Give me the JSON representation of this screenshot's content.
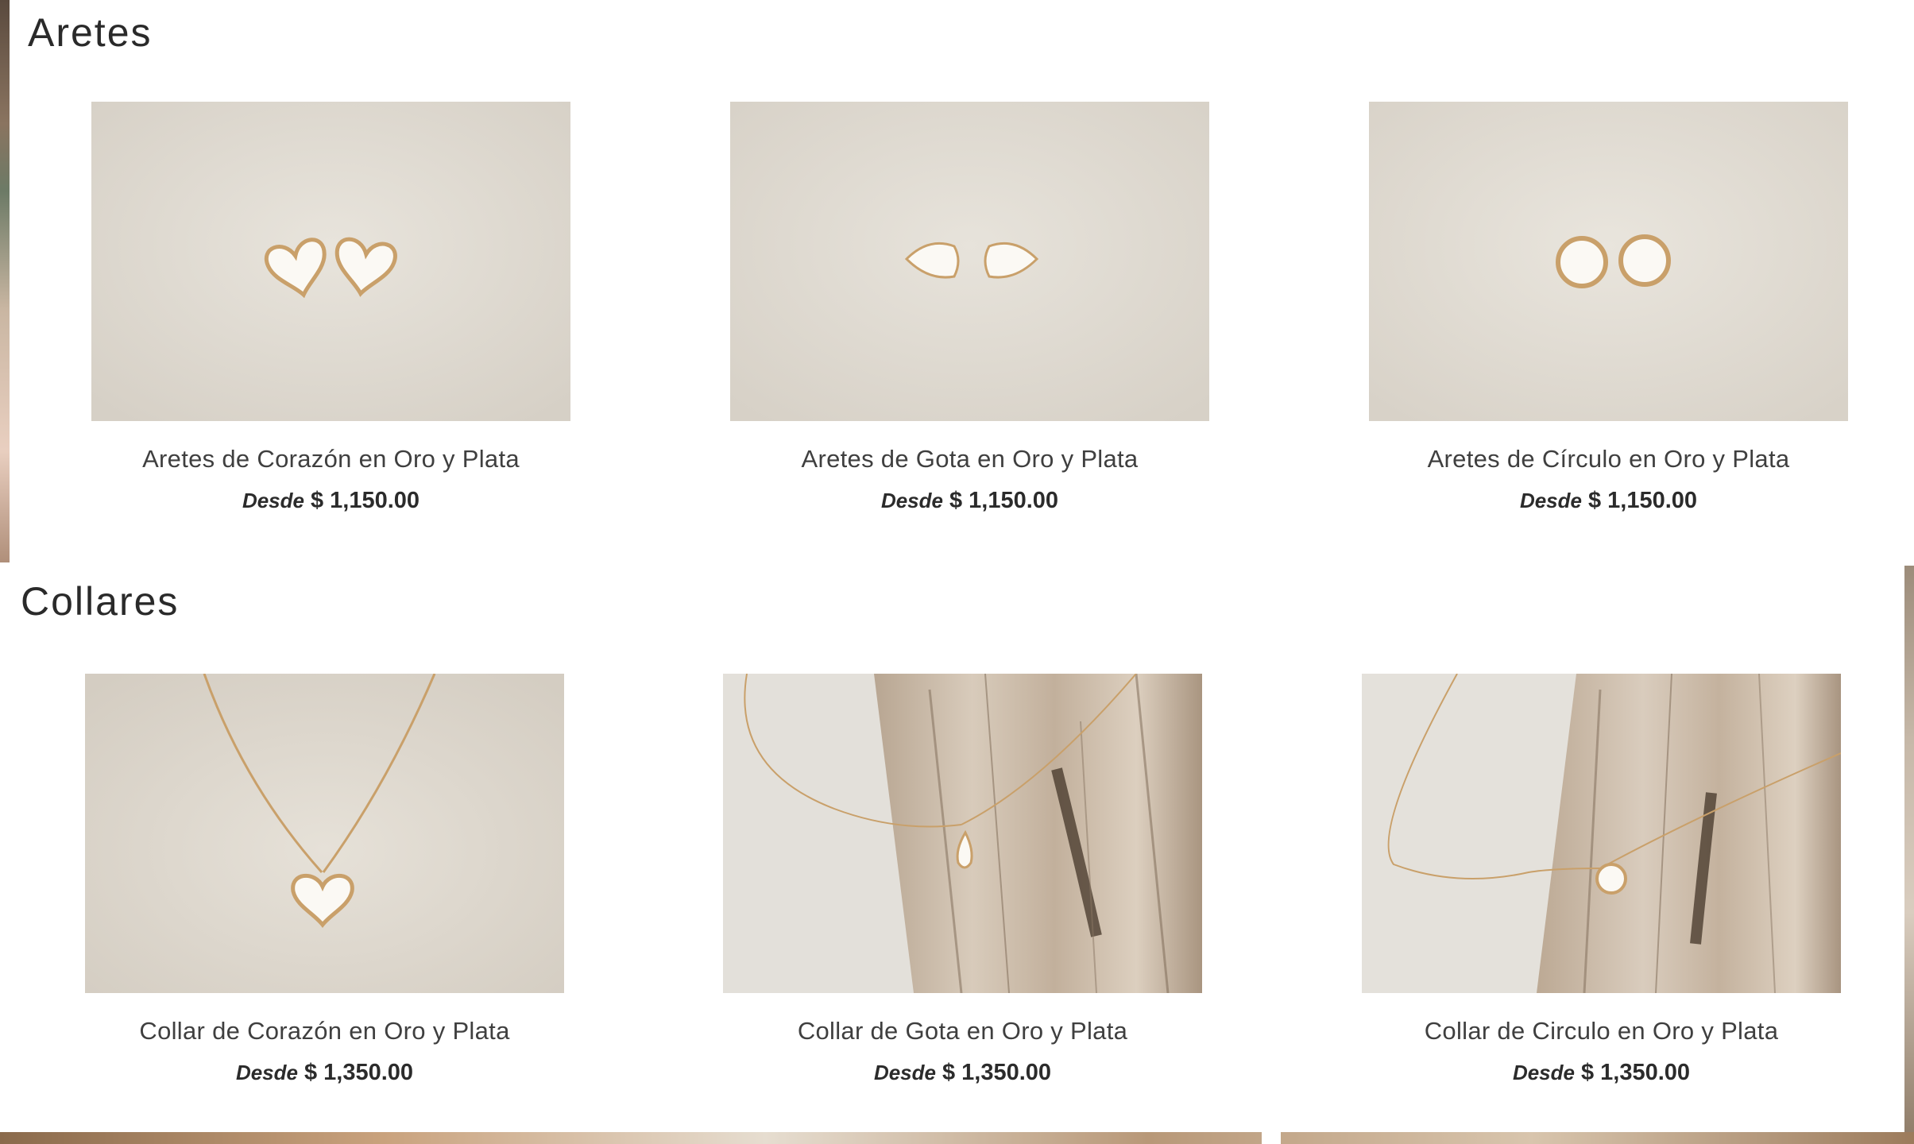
{
  "sections": [
    {
      "title": "Aretes",
      "products": [
        {
          "name": "Aretes de Corazón en Oro y Plata",
          "from_label": "Desde",
          "price": "$ 1,150.00",
          "image_icon": "heart-earrings-photo"
        },
        {
          "name": "Aretes de Gota en Oro y Plata",
          "from_label": "Desde",
          "price": "$ 1,150.00",
          "image_icon": "drop-earrings-photo"
        },
        {
          "name": "Aretes de Círculo en Oro y Plata",
          "from_label": "Desde",
          "price": "$ 1,150.00",
          "image_icon": "circle-earrings-photo"
        }
      ]
    },
    {
      "title": "Collares",
      "products": [
        {
          "name": "Collar de Corazón en Oro y Plata",
          "from_label": "Desde",
          "price": "$ 1,350.00",
          "image_icon": "heart-necklace-photo"
        },
        {
          "name": "Collar de Gota en Oro y Plata",
          "from_label": "Desde",
          "price": "$ 1,350.00",
          "image_icon": "drop-necklace-photo"
        },
        {
          "name": "Collar de Circulo en Oro y Plata",
          "from_label": "Desde",
          "price": "$ 1,350.00",
          "image_icon": "circle-necklace-photo"
        }
      ]
    }
  ],
  "colors": {
    "photo_background": "#ddd8d0",
    "gold": "#c9a06a",
    "enamel_white": "#fbf9f4",
    "driftwood": "#b9a793",
    "text": "#3f3f3f"
  }
}
